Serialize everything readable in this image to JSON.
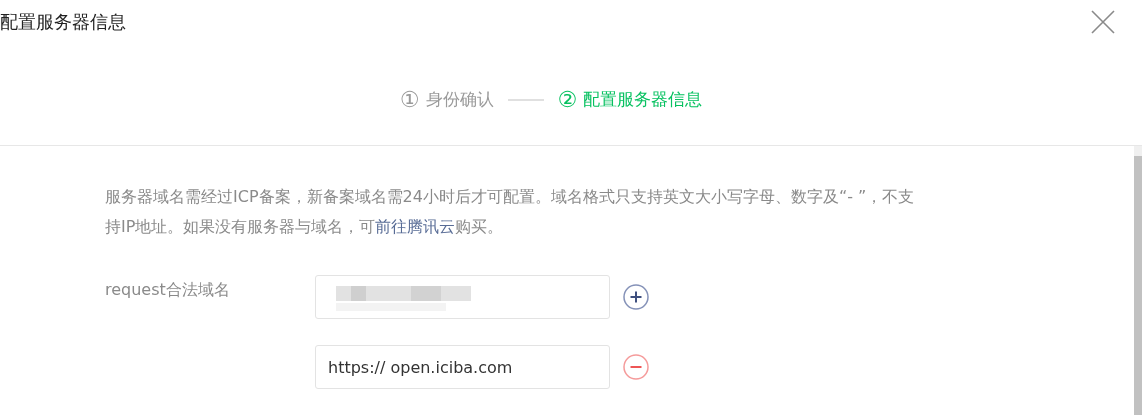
{
  "dialog": {
    "title": "配置服务器信息"
  },
  "steps": [
    {
      "number": "①",
      "label": "身份确认",
      "selected": false
    },
    {
      "number": "②",
      "label": "配置服务器信息",
      "selected": true
    }
  ],
  "notice": {
    "before": "服务器域名需经过ICP备案，新备案域名需24小时后才可配置。域名格式只支持英文大小写字母、数字及“- ”，不支持IP地址。如果没有服务器与域名，可",
    "link": "前往腾讯云",
    "after": "购买。"
  },
  "domains": {
    "label": "request合法域名",
    "fields": [
      {
        "kind": "redacted",
        "removable": false
      },
      {
        "kind": "text",
        "value": "https:// open.iciba.com",
        "removable": true
      }
    ]
  }
}
